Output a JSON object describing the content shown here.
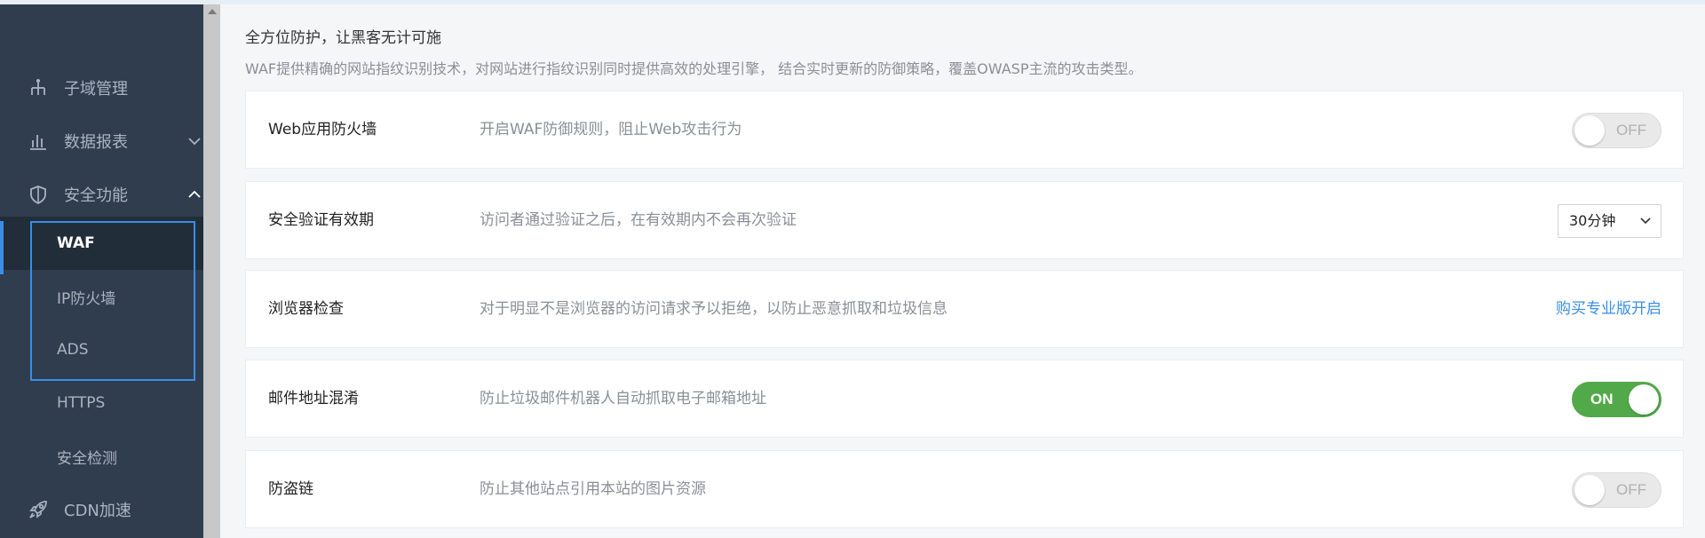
{
  "sidebar": {
    "items": [
      {
        "label": "子域管理",
        "icon": "sitemap-icon"
      },
      {
        "label": "数据报表",
        "icon": "bar-chart-icon"
      },
      {
        "label": "安全功能",
        "icon": "shield-icon"
      },
      {
        "label": "CDN加速",
        "icon": "rocket-icon"
      }
    ],
    "sub_items": [
      {
        "label": "WAF"
      },
      {
        "label": "IP防火墙"
      },
      {
        "label": "ADS"
      },
      {
        "label": "HTTPS"
      },
      {
        "label": "安全检测"
      }
    ],
    "active_sub": "WAF",
    "accent_color": "#3a8ee6",
    "bg_color": "#2f3d4e"
  },
  "main": {
    "headline": "全方位防护，让黑客无计可施",
    "subline": "WAF提供精确的网站指纹识别技术，对网站进行指纹识别同时提供高效的处理引擎， 结合实时更新的防御策略，覆盖OWASP主流的攻击类型。",
    "cards": [
      {
        "title": "Web应用防火墙",
        "desc": "开启WAF防御规则，阻止Web攻击行为",
        "toggle": "OFF"
      },
      {
        "title": "安全验证有效期",
        "desc": "访问者通过验证之后，在有效期内不会再次验证",
        "select": "30分钟"
      },
      {
        "title": "浏览器检查",
        "desc": "对于明显不是浏览器的访问请求予以拒绝，以防止恶意抓取和垃圾信息",
        "link": "购买专业版开启"
      },
      {
        "title": "邮件地址混淆",
        "desc": "防止垃圾邮件机器人自动抓取电子邮箱地址",
        "toggle": "ON"
      },
      {
        "title": "防盗链",
        "desc": "防止其他站点引用本站的图片资源",
        "toggle": "OFF"
      }
    ],
    "toggle_on_color": "#52a94a",
    "link_color": "#3a8ee6"
  }
}
